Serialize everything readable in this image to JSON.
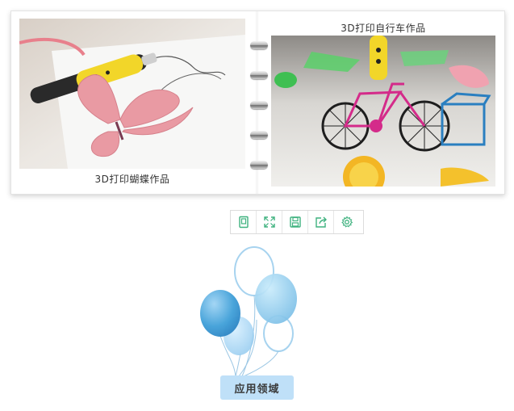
{
  "album": {
    "left_page": {
      "caption": "3D打印蝴蝶作品",
      "photo_icon": "butterfly-photo"
    },
    "right_page": {
      "caption": "3D打印自行车作品",
      "photo_icon": "bicycle-photo"
    }
  },
  "toolbar": {
    "buttons": [
      {
        "icon": "single-page-icon"
      },
      {
        "icon": "fullscreen-icon"
      },
      {
        "icon": "save-icon"
      },
      {
        "icon": "share-icon"
      },
      {
        "icon": "settings-icon"
      }
    ],
    "accent_color": "#3fb27f"
  },
  "section": {
    "button_label": "应用领域",
    "button_color": "#bfe0f8"
  }
}
